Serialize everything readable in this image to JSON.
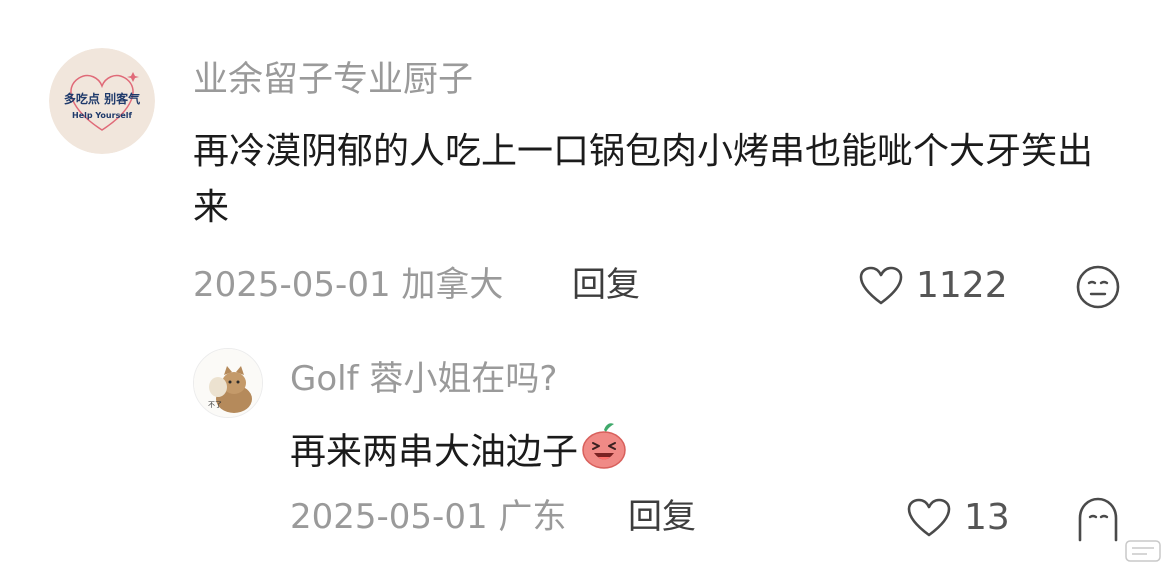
{
  "comment1": {
    "username": "业余留子专业厨子",
    "avatar_text_top": "多吃点 别客气",
    "avatar_text_bottom": "Help Yourself",
    "text": "再冷漠阴郁的人吃上一口锅包肉小烤串也能呲个大牙笑出来",
    "date_location": "2025-05-01 加拿大",
    "reply_label": "回复",
    "like_count": "1122",
    "like_icon": "heart-outline-icon",
    "reaction_icon": "neutral-face-icon"
  },
  "comment2": {
    "username": "Golf 蓉小姐在吗?",
    "avatar_caption": "不了",
    "text": "再来两串大油边子",
    "emoji": "laughing-peach-emoji",
    "date_location": "2025-05-01 广东",
    "reply_label": "回复",
    "like_count": "13",
    "like_icon": "heart-outline-icon",
    "reaction_icon": "ghost-face-icon"
  },
  "colors": {
    "text_primary": "#1b1b1b",
    "text_secondary": "#9a9a9a",
    "accent_navy": "#1f3a6b",
    "avatar_bg": "#f1e6dc",
    "heart_pink": "#e06a78"
  }
}
